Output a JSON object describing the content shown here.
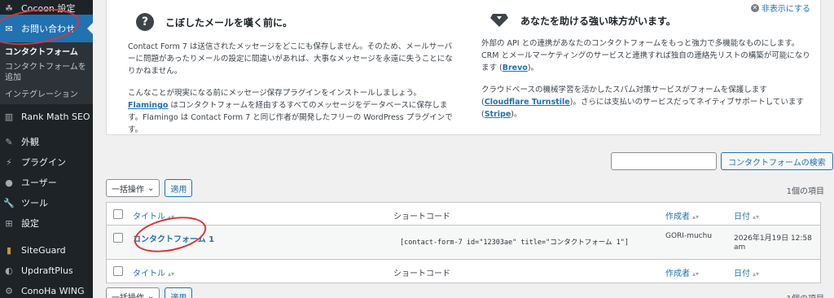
{
  "sidebar": {
    "top_item": "Cocoon 設定",
    "active_item": "お問い合わせ",
    "sub_items": [
      "コンタクトフォーム",
      "コンタクトフォームを追加",
      "インテグレーション"
    ],
    "items": [
      {
        "label": "Rank Math SEO",
        "icon": "rank-math-icon"
      },
      {
        "label": "外観",
        "icon": "paintbrush-icon"
      },
      {
        "label": "プラグイン",
        "icon": "plugin-icon"
      },
      {
        "label": "ユーザー",
        "icon": "user-icon"
      },
      {
        "label": "ツール",
        "icon": "wrench-icon"
      },
      {
        "label": "設定",
        "icon": "settings-icon"
      },
      {
        "label": "SiteGuard",
        "icon": "siteguard-icon"
      },
      {
        "label": "UpdraftPlus",
        "icon": "updraft-icon"
      },
      {
        "label": "ConoHa WING",
        "icon": "gear-icon"
      }
    ]
  },
  "welcome": {
    "dismiss": "非表示にする",
    "left": {
      "title": "こぼしたメールを嘆く前に。",
      "p1": "Contact Form 7 は送信されたメッセージをどこにも保存しません。そのため、メールサーバーに問題があったりメールの設定に間違いがあれば、大事なメッセージを永遠に失うことになりかねません。",
      "p2a": "こんなことが現実になる前にメッセージ保存プラグインをインストールしましょう。",
      "p2_link": "Flamingo",
      "p2b": " はコンタクトフォームを経由するすべてのメッセージをデータベースに保存します。Flamingo は Contact Form 7 と同じ作者が開発したフリーの WordPress プラグインです。"
    },
    "right": {
      "title": "あなたを助ける強い味方がいます。",
      "p1a": "外部の API との連携があなたのコンタクトフォームをもっと強力で多機能なものにします。CRM とメールマーケティングのサービスと連携すれば独自の連絡先リストの構築が可能になります (",
      "p1_link": "Brevo",
      "p1b": ")。",
      "p2a": "クラウドベースの機械学習を活かしたスパム対策サービスがフォームを保護します (",
      "p2_link1": "Cloudflare Turnstile",
      "p2b": ")。さらには支払いのサービスだってネイティブサポートしています (",
      "p2_link2": "Stripe",
      "p2c": ")。"
    }
  },
  "search": {
    "button": "コンタクトフォームの検索"
  },
  "bulk": {
    "label": "一括操作",
    "apply": "適用"
  },
  "count": "1個の項目",
  "table": {
    "headers": {
      "title": "タイトル",
      "shortcode": "ショートコード",
      "author": "作成者",
      "date": "日付"
    },
    "rows": [
      {
        "title": "コンタクトフォーム 1",
        "shortcode": "[contact-form-7 id=\"12303ae\" title=\"コンタクトフォーム 1\"]",
        "author": "GORI-muchu",
        "date_line1": "2026年1月19日 12:58",
        "date_line2": "am"
      }
    ]
  },
  "colors": {
    "accent": "#2271b1",
    "sidebar": "#1d2327",
    "annotation": "#d63638"
  }
}
